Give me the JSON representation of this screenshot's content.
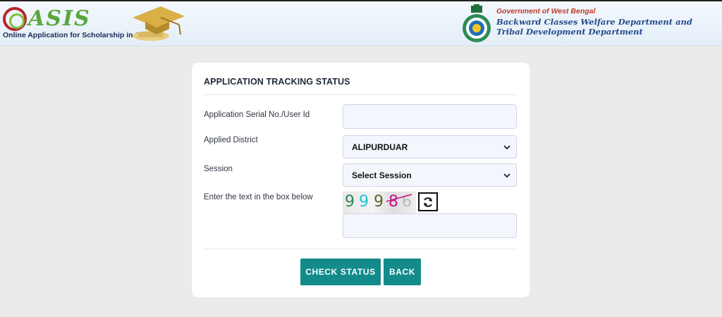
{
  "header": {
    "logo": {
      "letters": "ASIS",
      "tagline": "Online Application for Scholarship in Studies"
    },
    "govt": {
      "line1": "Government of West Bengal",
      "line2": "Backward Classes Welfare Department and",
      "line3": "Tribal Development Department"
    }
  },
  "form": {
    "title": "APPLICATION TRACKING STATUS",
    "serial_label": "Application Serial No./User Id",
    "serial_value": "",
    "district_label": "Applied District",
    "district_value": "ALIPURDUAR",
    "session_label": "Session",
    "session_value": "Select Session",
    "captcha_label": "Enter the text in the box below",
    "captcha_chars": [
      "9",
      "9",
      "9",
      "8",
      "6"
    ],
    "captcha_colors": [
      "#2e8b57",
      "#1ec6d6",
      "#556b2f",
      "#c2188a",
      "#bbbbbb"
    ],
    "captcha_value": "",
    "refresh_icon": "refresh-icon",
    "check_button": "CHECK STATUS",
    "back_button": "BACK"
  },
  "colors": {
    "accent": "#138b8b",
    "page_bg": "#ebebeb",
    "header_red": "#c0392b",
    "header_blue": "#234b8a"
  }
}
